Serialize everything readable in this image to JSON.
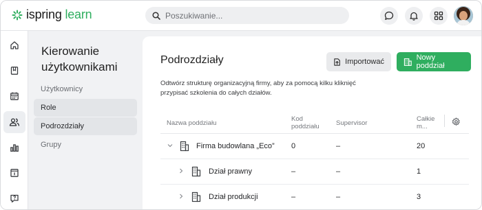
{
  "brand": {
    "name_main": "ispring",
    "name_accent": "learn",
    "accent_color": "#2fae5f"
  },
  "search": {
    "placeholder": "Poszukiwanie..."
  },
  "top_icons": [
    "chat-icon",
    "bell-icon",
    "apps-grid-icon"
  ],
  "rail": {
    "items": [
      {
        "name": "home-icon"
      },
      {
        "name": "book-icon"
      },
      {
        "name": "calendar-icon"
      },
      {
        "name": "users-icon",
        "active": true
      },
      {
        "name": "reports-icon"
      },
      {
        "name": "info-icon"
      },
      {
        "name": "help-icon"
      }
    ]
  },
  "subnav": {
    "title": "Kierowanie użytkownikami",
    "items": [
      {
        "label": "Użytkownicy"
      },
      {
        "label": "Role"
      },
      {
        "label": "Podrozdziały",
        "selected": true
      },
      {
        "label": "Grupy"
      }
    ]
  },
  "main": {
    "title": "Podrozdziały",
    "import_label": "Importować",
    "new_label": "Nowy poddział",
    "description": "Odtwórz strukturę organizacyjną firmy, aby za pomocą kilku kliknięć przypisać szkolenia do całych działów."
  },
  "table": {
    "headers": {
      "name": "Nazwa poddziału",
      "code": "Kod poddziału",
      "supervisor": "Supervisor",
      "total": "Całkie m..."
    },
    "rows": [
      {
        "name": "Firma budowlana „Eco”",
        "code": "0",
        "supervisor": "–",
        "total": "20",
        "expanded": true,
        "level": 0
      },
      {
        "name": "Dział prawny",
        "code": "–",
        "supervisor": "–",
        "total": "1",
        "expanded": false,
        "level": 1
      },
      {
        "name": "Dział produkcji",
        "code": "–",
        "supervisor": "–",
        "total": "3",
        "expanded": false,
        "level": 1
      }
    ]
  }
}
